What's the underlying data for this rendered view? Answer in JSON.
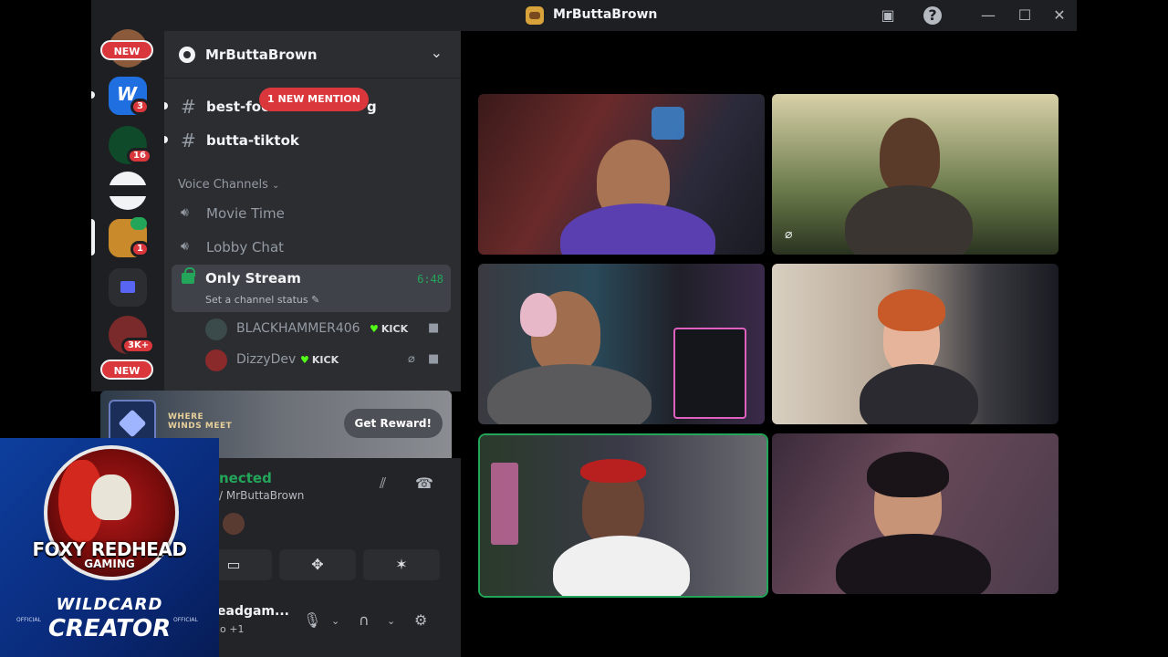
{
  "window": {
    "title": "MrButtaBrown",
    "minimize": "—",
    "maximize": "☐",
    "close": "✕"
  },
  "server_rail": {
    "new_label_top": "NEW",
    "new_label_bottom": "NEW",
    "servers": [
      {
        "badge": "3"
      },
      {
        "badge": "16"
      },
      {
        "badge": ""
      },
      {
        "badge": "1"
      },
      {
        "badge": ""
      },
      {
        "badge": "3K+"
      }
    ]
  },
  "server": {
    "name": "MrButtaBrown"
  },
  "text_channels": [
    {
      "name": "best-foo",
      "suffix": "g"
    },
    {
      "name": "butta-tiktok"
    }
  ],
  "mention_pill": "1 NEW MENTION",
  "voice_category": "Voice Channels",
  "voice_channels": [
    {
      "name": "Movie Time"
    },
    {
      "name": "Lobby Chat"
    }
  ],
  "active_channel": {
    "name": "Only Stream",
    "timer": "6:48",
    "status": "Set a channel status"
  },
  "members": [
    {
      "name": "BLACKHAMMER406",
      "tag": "KICK"
    },
    {
      "name": "DizzyDev",
      "tag": "KICK"
    }
  ],
  "reward": {
    "logo_line1": "WHERE",
    "logo_line2": "WINDS MEET",
    "button": "Get Reward!"
  },
  "voice_status": {
    "connected": "nected",
    "subtitle": "/ MrButtaBrown"
  },
  "user": {
    "name": "eadgam...",
    "status": "io +1"
  },
  "overlay": {
    "brand_line1": "FOXY REDHEAD",
    "brand_line2": "GAMING",
    "program_line1": "WILDCARD",
    "program_line2": "CREATOR",
    "official_left": "OFFICIAL",
    "official_right": "OFFICIAL"
  },
  "colors": {
    "accent_green": "#23a55a",
    "mention_red": "#da373c",
    "kick_green": "#53fc18"
  }
}
